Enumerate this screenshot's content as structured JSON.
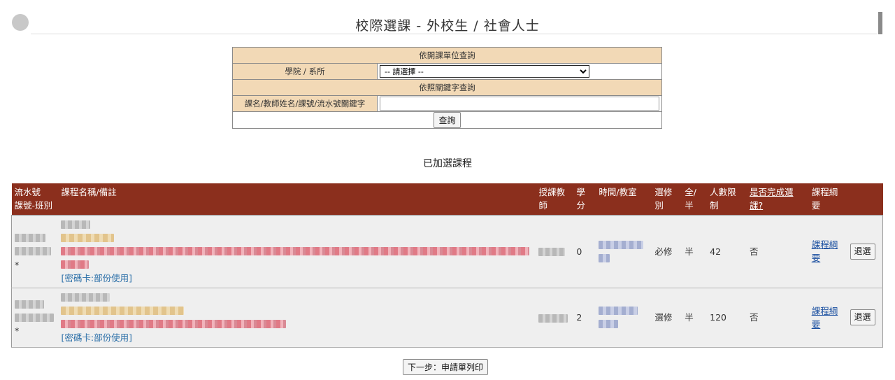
{
  "header": {
    "title": "校際選課 - 外校生 / 社會人士"
  },
  "query": {
    "section_unit": "依開課單位查詢",
    "college_label": "學院 / 系所",
    "college_selected": "-- 請選擇 --",
    "section_keyword": "依照關鍵字查詢",
    "keyword_label": "課名/教師姓名/課號/流水號關鍵字",
    "keyword_value": "",
    "search_label": "查詢"
  },
  "added": {
    "title": "已加選課程",
    "columns": {
      "serial": "流水號",
      "code_class": "課號-班別",
      "name_note": "課程名稱/備註",
      "teacher": "授課教師",
      "credits": "學分",
      "time_room": "時間/教室",
      "required": "選修別",
      "full_half": "全/半",
      "capacity": "人數限制",
      "completed": "是否完成選課?",
      "syllabus": "課程綱要"
    },
    "rows": [
      {
        "note": "[密碼卡:部份使用]",
        "credits": "0",
        "required": "必修",
        "full_half": "半",
        "capacity": "42",
        "completed": "否",
        "syllabus": "課程綱要",
        "action": "退選",
        "star": "*"
      },
      {
        "note": "[密碼卡:部份使用]",
        "credits": "2",
        "required": "選修",
        "full_half": "半",
        "capacity": "120",
        "completed": "否",
        "syllabus": "課程綱要",
        "action": "退選",
        "star": "*"
      }
    ]
  },
  "footer": {
    "next_label": "下一步：申請單列印"
  },
  "colors": {
    "header_bg": "#8b2f1d",
    "form_label_bg": "#f2d9b6",
    "row_bg": "#efefef",
    "note_color": "#2b6fa8"
  }
}
